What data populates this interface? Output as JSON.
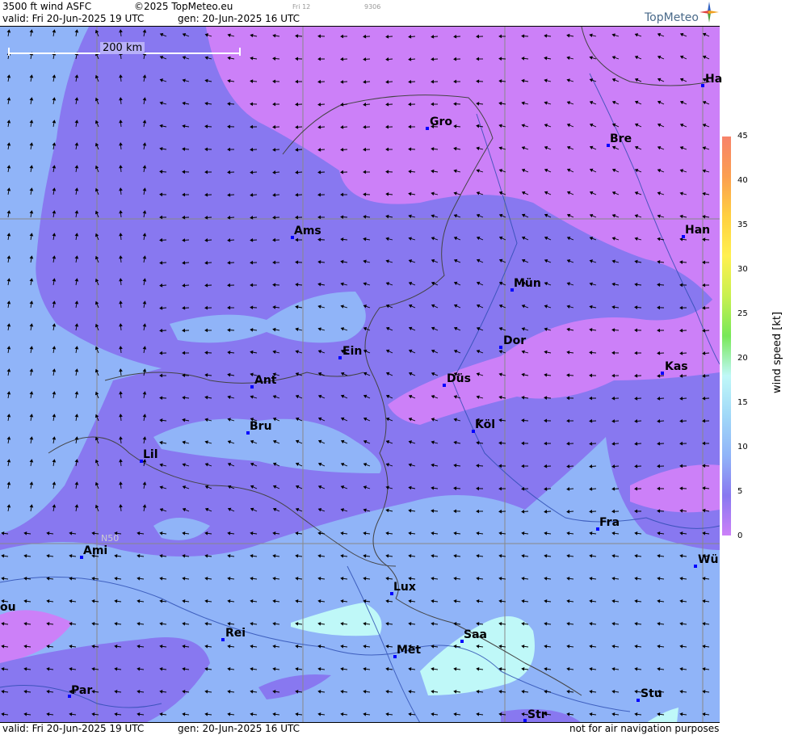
{
  "header": {
    "product": "3500 ft wind ASFC",
    "copyright": "©2025 TopMeteo.eu",
    "valid": "valid:  Fri  20-Jun-2025  19 UTC",
    "gen": "gen: 20-Jun-2025 16 UTC",
    "small1": "Fri 12",
    "small2": "9306",
    "logo": "TopMeteo"
  },
  "footer": {
    "valid": "valid:  Fri  20-Jun-2025  19 UTC",
    "gen": "gen: 20-Jun-2025 16 UTC",
    "disclaimer": "not for air navigation purposes"
  },
  "scale_label": "200 km",
  "lat_label": "N50",
  "legend": {
    "title": "wind  speed  [kt]",
    "ticks": [
      "45",
      "40",
      "35",
      "30",
      "25",
      "20",
      "15",
      "10",
      "5",
      "0"
    ],
    "colors": [
      "#f7836a",
      "#fb9f50",
      "#ffd040",
      "#fff050",
      "#c8f050",
      "#78e858",
      "#bff8f8",
      "#a0d8f8",
      "#90b4f8",
      "#8878f0",
      "#cc80f8"
    ]
  },
  "cities": [
    {
      "id": "gro",
      "label": "Gro"
    },
    {
      "id": "bre",
      "label": "Bre"
    },
    {
      "id": "ha",
      "label": "Ha"
    },
    {
      "id": "ams",
      "label": "Ams"
    },
    {
      "id": "han",
      "label": "Han"
    },
    {
      "id": "mun",
      "label": "Mün"
    },
    {
      "id": "dor",
      "label": "Dor"
    },
    {
      "id": "ein",
      "label": "Ein"
    },
    {
      "id": "ant",
      "label": "Ant"
    },
    {
      "id": "dus",
      "label": "Düs"
    },
    {
      "id": "kas",
      "label": "Kas"
    },
    {
      "id": "bru",
      "label": "Bru"
    },
    {
      "id": "kol",
      "label": "Köl"
    },
    {
      "id": "lil",
      "label": "Lil"
    },
    {
      "id": "fra",
      "label": "Fra"
    },
    {
      "id": "ami",
      "label": "Ami"
    },
    {
      "id": "wu",
      "label": "Wü"
    },
    {
      "id": "lux",
      "label": "Lux"
    },
    {
      "id": "ou",
      "label": "ou"
    },
    {
      "id": "rei",
      "label": "Rei"
    },
    {
      "id": "saa",
      "label": "Saa"
    },
    {
      "id": "met",
      "label": "Met"
    },
    {
      "id": "par",
      "label": "Par"
    },
    {
      "id": "stu",
      "label": "Stu"
    },
    {
      "id": "str",
      "label": "Str"
    }
  ]
}
